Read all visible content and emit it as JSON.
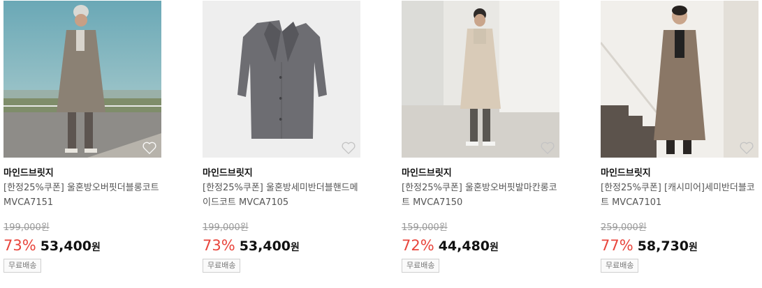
{
  "products": [
    {
      "brand": "마인드브릿지",
      "name": "[한정25%쿠폰] 울혼방오버핏더블롱코트 MVCA7151",
      "original_price": "199,000원",
      "discount_rate": "73%",
      "sale_price": "53,400",
      "currency": "원",
      "shipping": "무료배송",
      "image": "model-grey-double-coat-outdoor"
    },
    {
      "brand": "마인드브릿지",
      "name": "[한정25%쿠폰] 울혼방세미반더블핸드메이드코트 MVCA7105",
      "original_price": "199,000원",
      "discount_rate": "73%",
      "sale_price": "53,400",
      "currency": "원",
      "shipping": "무료배송",
      "image": "grey-coat-flatlay"
    },
    {
      "brand": "마인드브릿지",
      "name": "[한정25%쿠폰] 울혼방오버핏발마칸롱코트 MVCA7150",
      "original_price": "159,000원",
      "discount_rate": "72%",
      "sale_price": "44,480",
      "currency": "원",
      "shipping": "무료배송",
      "image": "model-beige-balmacaan-coat-studio"
    },
    {
      "brand": "마인드브릿지",
      "name": "[한정25%쿠폰] [캐시미어]세미반더블코트 MVCA7101",
      "original_price": "259,000원",
      "discount_rate": "77%",
      "sale_price": "58,730",
      "currency": "원",
      "shipping": "무료배송",
      "image": "model-brown-coat-staircase"
    }
  ],
  "icons": {
    "wishlist": "heart-outline-icon"
  },
  "colors": {
    "discount": "#e8453c",
    "price": "#111111",
    "original": "#999999"
  }
}
